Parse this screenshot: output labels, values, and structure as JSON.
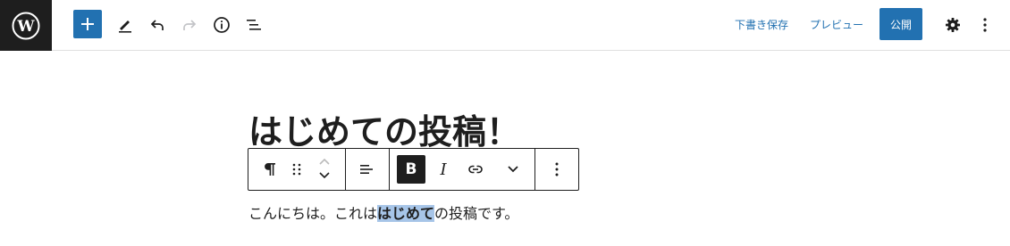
{
  "topbar": {
    "logo_icon": "wordpress-logo-icon",
    "add_icon": "plus-icon",
    "tools_icon": "pencil-icon",
    "undo_icon": "undo-icon",
    "redo_icon": "redo-icon",
    "info_icon": "info-icon",
    "outline_icon": "list-view-icon",
    "save_draft_label": "下書き保存",
    "preview_label": "プレビュー",
    "publish_label": "公開",
    "settings_icon": "gear-icon",
    "more_icon": "vertical-ellipsis-icon",
    "accent_color": "#2271b1"
  },
  "editor": {
    "title": "はじめての投稿！",
    "paragraph": {
      "before": "こんにちは。これは",
      "selected": "はじめて",
      "after": "の投稿です。"
    }
  },
  "block_toolbar": {
    "block_type_icon": "pilcrow-icon",
    "drag_icon": "drag-handle-icon",
    "move_up_icon": "chevron-up-icon",
    "move_down_icon": "chevron-down-icon",
    "align_icon": "align-left-icon",
    "bold_label": "B",
    "italic_label": "I",
    "link_icon": "link-icon",
    "more_rich_text_icon": "chevron-down-icon",
    "options_icon": "vertical-ellipsis-icon"
  }
}
